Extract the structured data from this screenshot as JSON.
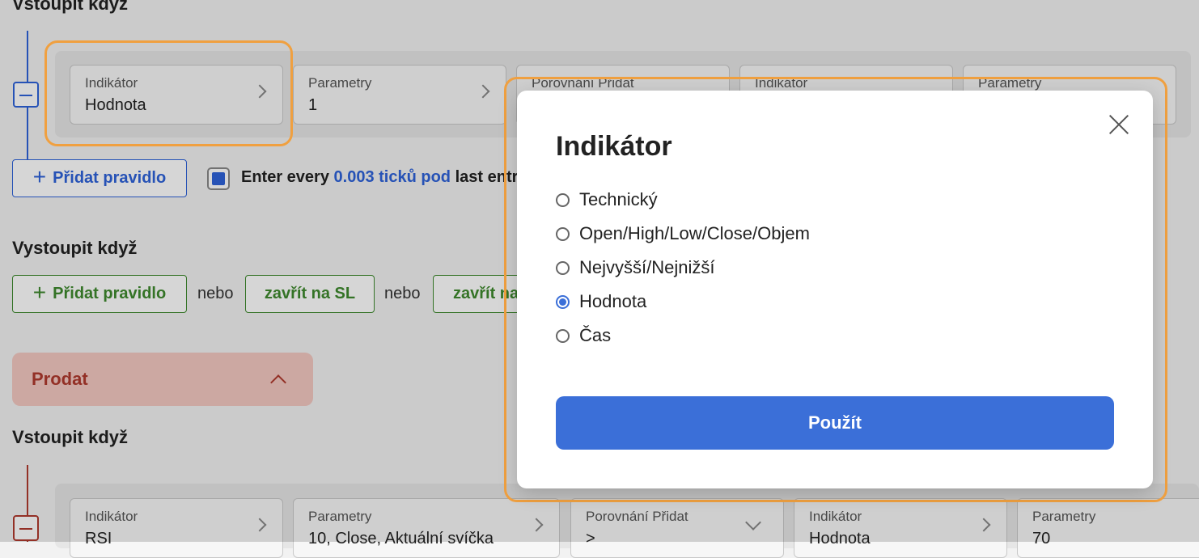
{
  "colors": {
    "blue": "#2e62d9",
    "green": "#3e8a2e",
    "red": "#b03a2e",
    "sell_bg": "#f3c9c2",
    "highlight": "#f0a040",
    "primary_button": "#3b6fd8"
  },
  "top_section": {
    "title": "Vstoupit když",
    "fields": [
      {
        "label": "Indikátor",
        "value": "Hodnota"
      },
      {
        "label": "Parametry",
        "value": "1"
      },
      {
        "label": "Porovnání Přidat",
        "value": ""
      },
      {
        "label": "Indikátor",
        "value": ""
      },
      {
        "label": "Parametry",
        "value": ""
      }
    ],
    "add_rule_label": "Přidat pravidlo",
    "enter_every": {
      "prefix": "Enter every",
      "link": "0.003 ticků pod",
      "suffix": "last entry"
    }
  },
  "exit_section": {
    "title": "Vystoupit když",
    "add_rule_label": "Přidat pravidlo",
    "or_label": "nebo",
    "close_sl_label": "zavřít na SL",
    "close_tp_label": "zavřít na TP"
  },
  "sell": {
    "label": "Prodat",
    "icon": "chevron-up-icon"
  },
  "bottom_section": {
    "title": "Vstoupit když",
    "fields": [
      {
        "label": "Indikátor",
        "value": "RSI"
      },
      {
        "label": "Parametry",
        "value": "10, Close, Aktuální svíčka"
      },
      {
        "label": "Porovnání Přidat",
        "value": ">"
      },
      {
        "label": "Indikátor",
        "value": "Hodnota"
      },
      {
        "label": "Parametry",
        "value": "70"
      }
    ]
  },
  "modal": {
    "title": "Indikátor",
    "options": [
      {
        "label": "Technický",
        "selected": false
      },
      {
        "label": "Open/High/Low/Close/Objem",
        "selected": false
      },
      {
        "label": "Nejvyšší/Nejnižší",
        "selected": false
      },
      {
        "label": "Hodnota",
        "selected": true
      },
      {
        "label": "Čas",
        "selected": false
      }
    ],
    "apply_label": "Použít"
  }
}
